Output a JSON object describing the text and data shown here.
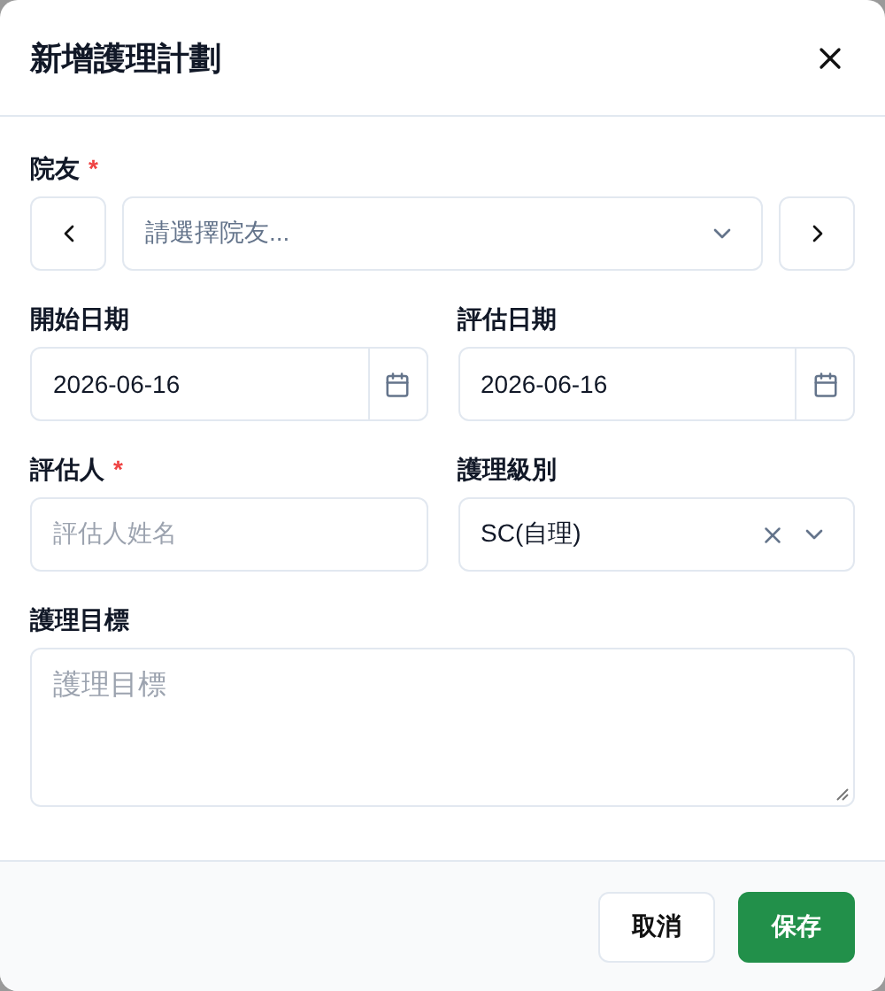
{
  "dialog": {
    "title": "新增護理計劃"
  },
  "fields": [
    {
      "kind": "resident",
      "label": "院友",
      "required_mark": "*",
      "placeholder": "請選擇院友..."
    },
    {
      "kind": "date",
      "label": "開始日期",
      "value": "2026-06-16"
    },
    {
      "kind": "date",
      "label": "評估日期",
      "value": "2026-06-16"
    },
    {
      "kind": "text",
      "label": "評估人",
      "required_mark": "*",
      "placeholder": "評估人姓名"
    },
    {
      "kind": "select",
      "label": "護理級別",
      "value": "SC(自理)"
    },
    {
      "kind": "textarea",
      "label": "護理目標",
      "placeholder": "護理目標"
    }
  ],
  "buttons": [
    {
      "label": "取消",
      "kind": "secondary"
    },
    {
      "label": "保存",
      "kind": "primary"
    }
  ]
}
